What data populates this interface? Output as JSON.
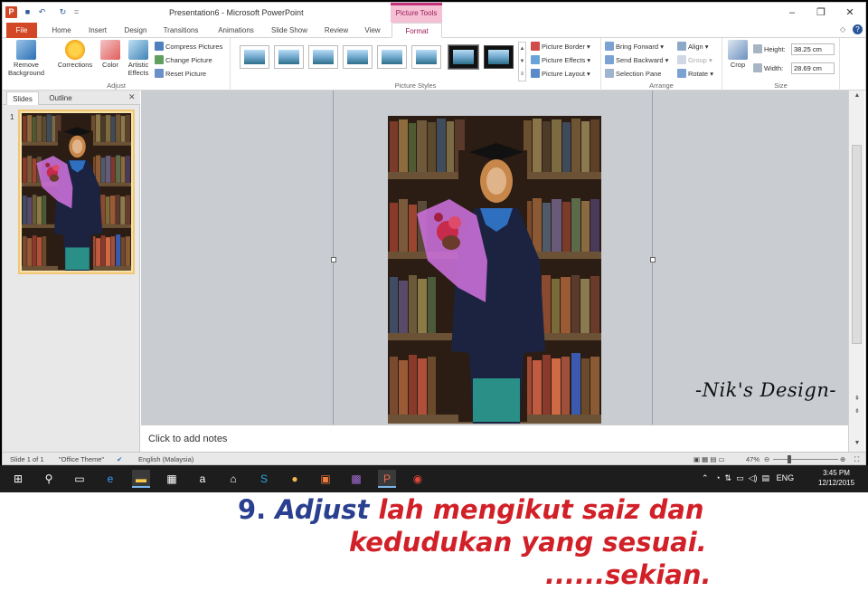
{
  "window": {
    "title": "Presentation6 - Microsoft PowerPoint",
    "context_group": "Picture Tools",
    "min": "–",
    "max": "❐",
    "close": "✕"
  },
  "qat": {
    "logo": "P",
    "save": "■",
    "undo": "↶",
    "redo": "↻",
    "customize": "="
  },
  "tabs": [
    "File",
    "Home",
    "Insert",
    "Design",
    "Transitions",
    "Animations",
    "Slide Show",
    "Review",
    "View",
    "Format"
  ],
  "ribbon": {
    "adjust": {
      "label": "Adjust",
      "remove_background": "Remove Background",
      "corrections": "Corrections",
      "color": "Color",
      "artistic_effects": "Artistic Effects",
      "compress": "Compress Pictures",
      "change": "Change Picture",
      "reset": "Reset Picture"
    },
    "styles": {
      "label": "Picture Styles",
      "border": "Picture Border",
      "effects": "Picture Effects",
      "layout": "Picture Layout"
    },
    "arrange": {
      "label": "Arrange",
      "bring_forward": "Bring Forward",
      "send_backward": "Send Backward",
      "selection_pane": "Selection Pane",
      "align": "Align",
      "group": "Group",
      "rotate": "Rotate"
    },
    "size": {
      "label": "Size",
      "crop": "Crop",
      "height_label": "Height:",
      "height_value": "38.25 cm",
      "width_label": "Width:",
      "width_value": "28.69 cm"
    }
  },
  "panel": {
    "slides_tab": "Slides",
    "outline_tab": "Outline",
    "close": "✕",
    "slide_number": "1"
  },
  "notes": {
    "placeholder": "Click to add notes"
  },
  "watermark": "-Nik's Design-",
  "status": {
    "slide": "Slide 1 of 1",
    "theme": "\"Office Theme\"",
    "language": "English (Malaysia)",
    "zoom": "47%"
  },
  "taskbar": {
    "tray_lang": "ENG",
    "time": "3:45 PM",
    "date": "12/12/2015"
  },
  "caption": {
    "number": "9.",
    "word_blue": "Adjust",
    "line1_rest": "lah mengikut saiz dan",
    "line2": "kedudukan yang sesuai.",
    "line3": "......sekian."
  },
  "colors": {
    "file_tab": "#d24726",
    "context_tab": "#c4327a",
    "caption_red": "#d12027",
    "caption_blue": "#2a3f8f"
  }
}
